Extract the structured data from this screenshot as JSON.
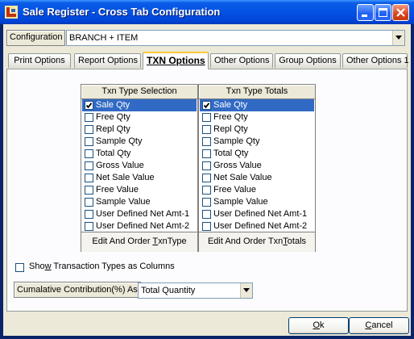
{
  "window": {
    "title": "Sale Register - Cross Tab Configuration"
  },
  "config": {
    "label": "Configuration",
    "value": "BRANCH + ITEM"
  },
  "tabs": [
    {
      "label": "Print Options",
      "active": false
    },
    {
      "label": "Report Options",
      "active": false
    },
    {
      "label": "TXN Options",
      "active": true
    },
    {
      "label": "Other Options",
      "active": false
    },
    {
      "label": "Group Options",
      "active": false
    },
    {
      "label": "Other Options 1",
      "active": false
    }
  ],
  "selection": {
    "header": "Txn Type Selection",
    "button_prefix": "Edit And Order ",
    "button_key": "T",
    "button_suffix": "xnType",
    "items": [
      {
        "label": "Sale Qty",
        "checked": true,
        "selected": true
      },
      {
        "label": "Free Qty",
        "checked": false,
        "selected": false
      },
      {
        "label": "Repl Qty",
        "checked": false,
        "selected": false
      },
      {
        "label": "Sample Qty",
        "checked": false,
        "selected": false
      },
      {
        "label": "Total Qty",
        "checked": false,
        "selected": false
      },
      {
        "label": "Gross Value",
        "checked": false,
        "selected": false
      },
      {
        "label": "Net Sale Value",
        "checked": false,
        "selected": false
      },
      {
        "label": "Free Value",
        "checked": false,
        "selected": false
      },
      {
        "label": "Sample Value",
        "checked": false,
        "selected": false
      },
      {
        "label": "User Defined Net Amt-1",
        "checked": false,
        "selected": false
      },
      {
        "label": "User Defined Net Amt-2",
        "checked": false,
        "selected": false
      }
    ]
  },
  "totals": {
    "header": "Txn Type Totals",
    "button_prefix": "Edit And Order Txn",
    "button_key": "T",
    "button_suffix": "otals",
    "items": [
      {
        "label": "Sale Qty",
        "checked": true,
        "selected": true
      },
      {
        "label": "Free Qty",
        "checked": false,
        "selected": false
      },
      {
        "label": "Repl Qty",
        "checked": false,
        "selected": false
      },
      {
        "label": "Sample Qty",
        "checked": false,
        "selected": false
      },
      {
        "label": "Total Qty",
        "checked": false,
        "selected": false
      },
      {
        "label": "Gross Value",
        "checked": false,
        "selected": false
      },
      {
        "label": "Net Sale Value",
        "checked": false,
        "selected": false
      },
      {
        "label": "Free Value",
        "checked": false,
        "selected": false
      },
      {
        "label": "Sample Value",
        "checked": false,
        "selected": false
      },
      {
        "label": "User Defined Net Amt-1",
        "checked": false,
        "selected": false
      },
      {
        "label": "User Defined Net Amt-2",
        "checked": false,
        "selected": false
      }
    ]
  },
  "show_columns": {
    "prefix": "Sho",
    "key": "w",
    "suffix": " Transaction Types as Columns",
    "checked": false
  },
  "cumulative": {
    "label": "Cumalative Contribution(%) As",
    "value": "Total Quantity"
  },
  "buttons": {
    "ok_key": "O",
    "ok_rest": "k",
    "cancel_key": "C",
    "cancel_rest": "ancel"
  }
}
